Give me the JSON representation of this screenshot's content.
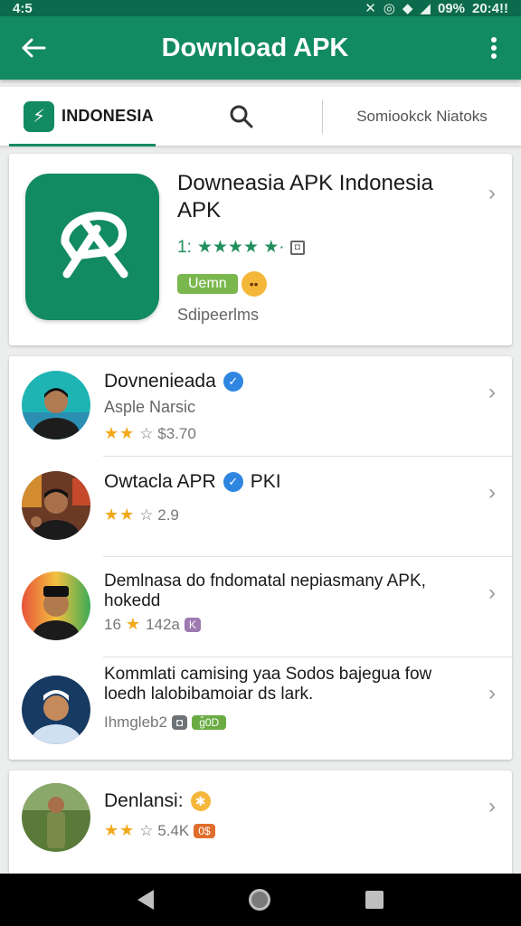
{
  "status": {
    "time_left": "4:5",
    "battery": "09%",
    "time_right": "20:4!!"
  },
  "appbar": {
    "title": "Download APK",
    "back_icon": "arrow-left-icon",
    "menu_icon": "more-vert-icon"
  },
  "tabs": {
    "active_label": "INDONESIA",
    "search_icon": "search-icon",
    "extra_label": "Somiookck Niatoks"
  },
  "featured": {
    "title": "Downeasia APK Indonesia APK",
    "rating_prefix": "1:",
    "rating_stars": "★★★★ ★·",
    "badge": "Uemn",
    "subtitle": "Sdipeerlms",
    "accent": "#128a62"
  },
  "list": [
    {
      "title": "Dovnenieada",
      "verified": true,
      "subtitle": "Asple Narsic",
      "stars": "★★",
      "meta": "☆ $3.70"
    },
    {
      "title": "Owtacla APR",
      "suffix": "PKI",
      "verified": true,
      "stars": "★★",
      "meta": "☆ 2.9"
    },
    {
      "title": "Demlnasa do fndomatal nepiasmany APK, hokedd",
      "meta_prefix": "16",
      "stars": "★",
      "meta": "142a",
      "tag": "K"
    },
    {
      "title": "Kommlati camising yaa Sodos bajegua fow loedh lalobibamoiar ds lark.",
      "meta": "Ihmgleb2",
      "tag1": "◘",
      "tag2": "ɡ̂0D"
    }
  ],
  "bottom_item": {
    "title": "Denlansi:",
    "stars": "★★",
    "meta": "☆ 5.4K",
    "tag": "0$"
  },
  "navbar": {
    "back": "nav-back-icon",
    "home": "nav-home-icon",
    "recents": "nav-recents-icon"
  }
}
